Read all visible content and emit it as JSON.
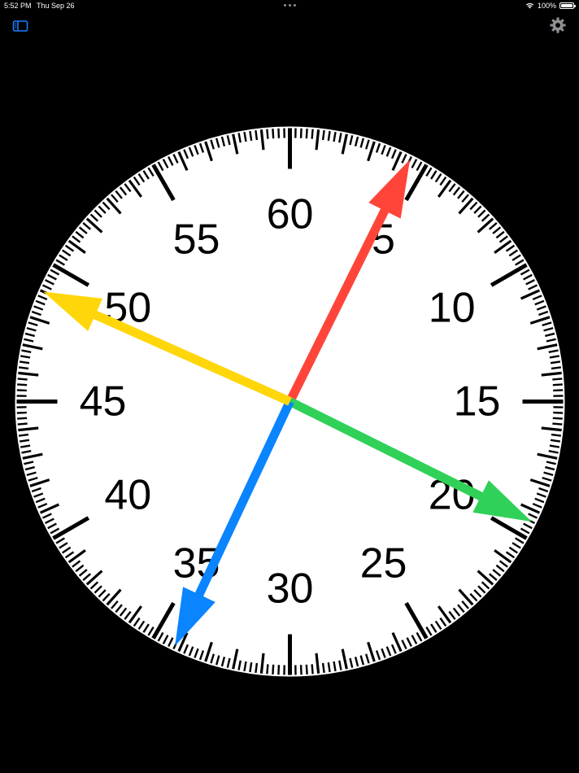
{
  "status_bar": {
    "time": "5:52 PM",
    "date": "Thu Sep 26",
    "battery": "100%"
  },
  "toolbar": {
    "sidebar_icon": "sidebar-toggle-icon",
    "settings_icon": "gear-icon",
    "accent_color": "#1a7cff",
    "settings_color": "#8e8e93"
  },
  "clock": {
    "numbers": [
      "60",
      "5",
      "10",
      "15",
      "20",
      "25",
      "30",
      "35",
      "40",
      "45",
      "50",
      "55"
    ],
    "ticks_per_revolution": 60,
    "hands": [
      {
        "name": "red",
        "color": "#ff453a",
        "reading": 4.4
      },
      {
        "name": "green",
        "color": "#30d158",
        "reading": 19.4
      },
      {
        "name": "blue",
        "color": "#0a84ff",
        "reading": 34.2
      },
      {
        "name": "yellow",
        "color": "#ffd60a",
        "reading": 49.0
      }
    ]
  }
}
